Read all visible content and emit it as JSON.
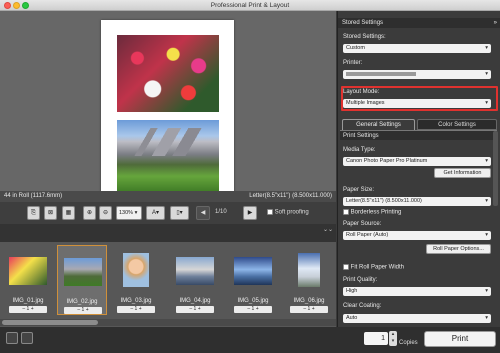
{
  "window": {
    "title": "Professional Print & Layout"
  },
  "preview": {
    "roll_info": "44 in Roll (1117.6mm)",
    "paper_info": "Letter(8.5\"x11\") (8.500x11.000)"
  },
  "toolbar": {
    "zoom_value": "130%",
    "page_indicator": "1/10",
    "soft_proofing_label": "Soft proofing"
  },
  "thumbnails": [
    {
      "name": "IMG_01.jpg",
      "count": "1"
    },
    {
      "name": "IMG_02.jpg",
      "count": "1"
    },
    {
      "name": "IMG_03.jpg",
      "count": "1"
    },
    {
      "name": "IMG_04.jpg",
      "count": "1"
    },
    {
      "name": "IMG_05.jpg",
      "count": "1"
    },
    {
      "name": "IMG_06.jpg",
      "count": "1"
    }
  ],
  "footer": {
    "copies_value": "1",
    "copies_label": "Copies",
    "print_label": "Print"
  },
  "panel": {
    "header": "Stored Settings",
    "stored_settings_label": "Stored Settings:",
    "stored_settings_value": "Custom",
    "printer_label": "Printer:",
    "printer_value": "",
    "layout_mode_label": "Layout Mode:",
    "layout_mode_value": "Multiple Images",
    "tabs": {
      "general": "General Settings",
      "color": "Color Settings"
    },
    "print_settings_header": "Print Settings",
    "media_type_label": "Media Type:",
    "media_type_value": "Canon Photo Paper Pro Platinum",
    "get_information_button": "Get Information",
    "paper_size_label": "Paper Size:",
    "paper_size_value": "Letter(8.5\"x11\") (8.500x11.000)",
    "borderless_label": "Borderless Printing",
    "paper_source_label": "Paper Source:",
    "paper_source_value": "Roll Paper (Auto)",
    "roll_paper_options_button": "Roll Paper Options...",
    "fit_roll_label": "Fit Roll Paper Width",
    "print_quality_label": "Print Quality:",
    "print_quality_value": "High",
    "clear_coating_label": "Clear Coating:",
    "clear_coating_value": "Auto"
  },
  "colors": {
    "highlight": "#e0322f",
    "selected_thumb_border": "#d0903a"
  }
}
